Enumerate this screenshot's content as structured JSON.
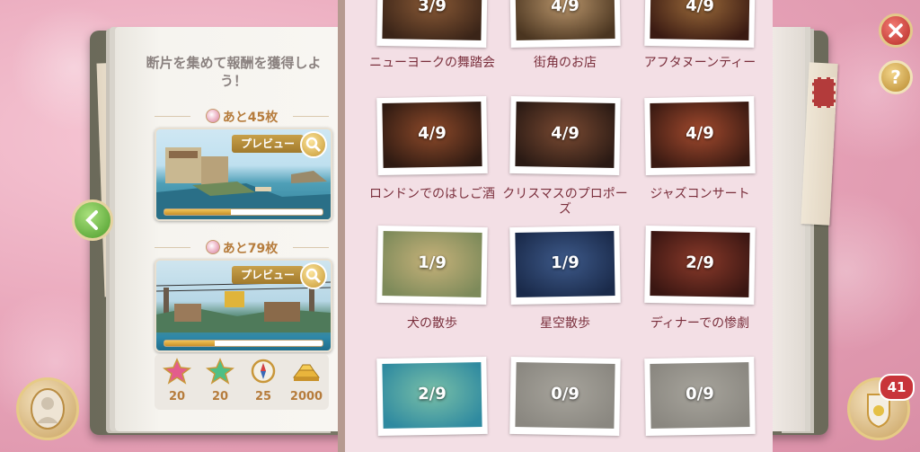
{
  "left_page": {
    "heading": "断片を集めて報酬を獲得しよう！",
    "cards": [
      {
        "remaining": "あと45枚",
        "preview_label": "プレビュー",
        "progress": 0.42
      },
      {
        "remaining": "あと79枚",
        "preview_label": "プレビュー",
        "progress": 0.32
      }
    ],
    "rewards": [
      {
        "icon": "pink-star-icon",
        "value": "20"
      },
      {
        "icon": "green-star-icon",
        "value": "20"
      },
      {
        "icon": "compass-icon",
        "value": "25"
      },
      {
        "icon": "gold-bars-icon",
        "value": "2000"
      }
    ]
  },
  "gallery": [
    {
      "progress": "3/9",
      "caption": "ニューヨークの舞踏会",
      "colors": [
        "#3a2418",
        "#8a5a36"
      ]
    },
    {
      "progress": "4/9",
      "caption": "街角のお店",
      "colors": [
        "#4a3520",
        "#b9956b"
      ]
    },
    {
      "progress": "4/9",
      "caption": "アフタヌーンティー",
      "colors": [
        "#3a1a12",
        "#9a6a3a"
      ]
    },
    {
      "progress": "4/9",
      "caption": "ロンドンでのはしご酒",
      "colors": [
        "#2e1a12",
        "#8e4a2a"
      ]
    },
    {
      "progress": "4/9",
      "caption": "クリスマスのプロポーズ",
      "colors": [
        "#2a1a14",
        "#7a4a32"
      ]
    },
    {
      "progress": "4/9",
      "caption": "ジャズコンサート",
      "colors": [
        "#3a1a12",
        "#a24a2e"
      ]
    },
    {
      "progress": "1/9",
      "caption": "犬の散歩",
      "colors": [
        "#7d8a5a",
        "#c7b27a"
      ]
    },
    {
      "progress": "1/9",
      "caption": "星空散歩",
      "colors": [
        "#1a2a4a",
        "#3e5a8a"
      ]
    },
    {
      "progress": "2/9",
      "caption": "ディナーでの惨劇",
      "colors": [
        "#3a1612",
        "#8a3a2a"
      ]
    },
    {
      "progress": "2/9",
      "caption": "",
      "colors": [
        "#2f8aa0",
        "#7ac0a8"
      ]
    },
    {
      "progress": "0/9",
      "caption": "",
      "colors": [
        "#8a8780",
        "#a7a49c"
      ]
    },
    {
      "progress": "0/9",
      "caption": "",
      "colors": [
        "#8a8780",
        "#a7a49c"
      ]
    }
  ],
  "hud": {
    "badge_count": "41"
  }
}
